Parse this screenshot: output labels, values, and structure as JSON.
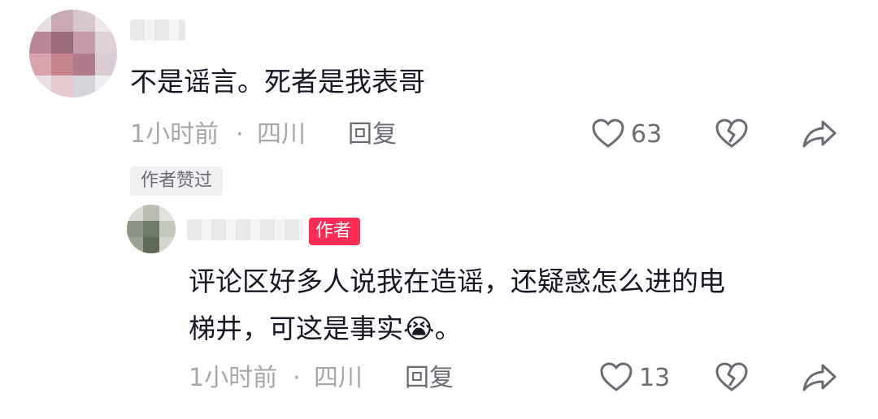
{
  "comments": {
    "top": {
      "text": "不是谣言。死者是我表哥",
      "time": "1小时前",
      "separator": "·",
      "location": "四川",
      "reply_label": "回复",
      "like_count": "63",
      "liked_by_author_label": "作者赞过"
    },
    "reply": {
      "author_badge": "作者",
      "text_line1": "评论区好多人说我在造谣，还疑惑怎么进的电",
      "text_line2": "梯井，可这是事实",
      "emoji": "😭",
      "text_end": "。",
      "time": "1小时前",
      "separator": "·",
      "location": "四川",
      "reply_label": "回复",
      "like_count": "13"
    }
  },
  "colors": {
    "text": "#161823",
    "meta": "#a6a7ab",
    "secondary": "#6b6c73",
    "author_badge": "#fe2c55",
    "liked_badge_bg": "#f1f1f3"
  },
  "icons": [
    "heart-icon",
    "dislike-broken-heart-icon",
    "share-arrow-icon",
    "crying-face-emoji"
  ]
}
